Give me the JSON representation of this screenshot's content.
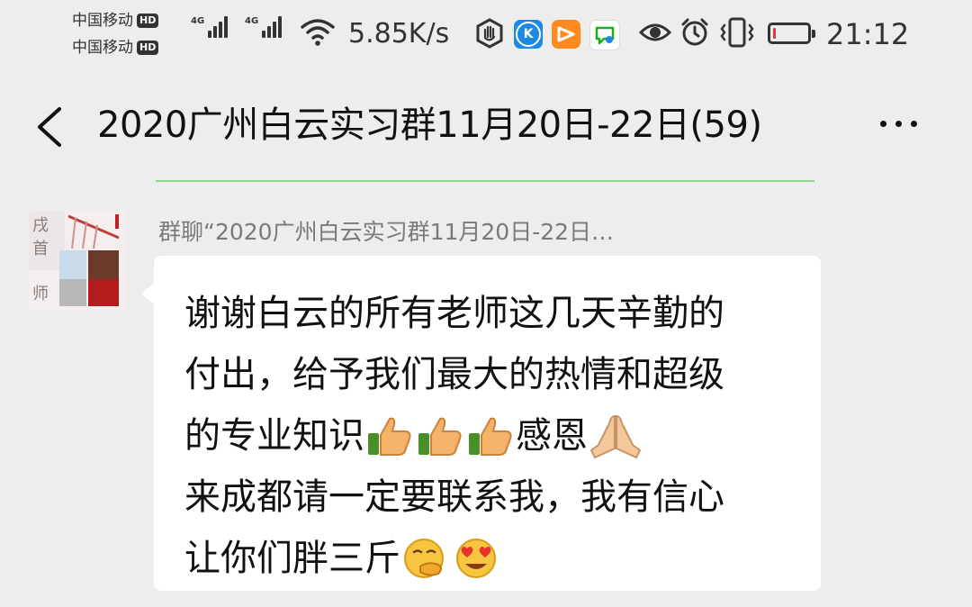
{
  "status_bar": {
    "carrier_1": "中国移动",
    "carrier_2": "中国移动",
    "hd_label": "HD",
    "network_1": "4G",
    "network_2": "4G",
    "net_speed": "5.85K/s",
    "app_k_label": "K",
    "battery_level": 0.08,
    "battery_color": "#e53935",
    "time": "21:12",
    "icons": [
      "signal-icon",
      "wifi-icon",
      "hand-icon",
      "kugou-icon",
      "video-icon",
      "chat-icon",
      "eye-icon",
      "alarm-icon",
      "vibrate-icon",
      "battery-icon"
    ]
  },
  "header": {
    "title": "2020广州白云实习群11月20日-22日(59)",
    "back_icon": "chevron-left-icon",
    "more_icon": "more-dots-icon",
    "divider_color": "#8ed68e"
  },
  "message": {
    "sender": "群聊“2020广州白云实习群11月20日-22日…",
    "lines": [
      "谢谢白云的所有老师这几天辛勤的",
      "付出，给予我们最大的热情和超级",
      "的专业知识",
      "感恩",
      "来成都请一定要联系我，我有信心",
      "让你们胖三斤"
    ],
    "emojis": [
      "thumbs-up-icon",
      "thumbs-up-icon",
      "thumbs-up-icon",
      "praying-hands-icon",
      "hand-over-mouth-icon",
      "heart-eyes-icon"
    ]
  }
}
